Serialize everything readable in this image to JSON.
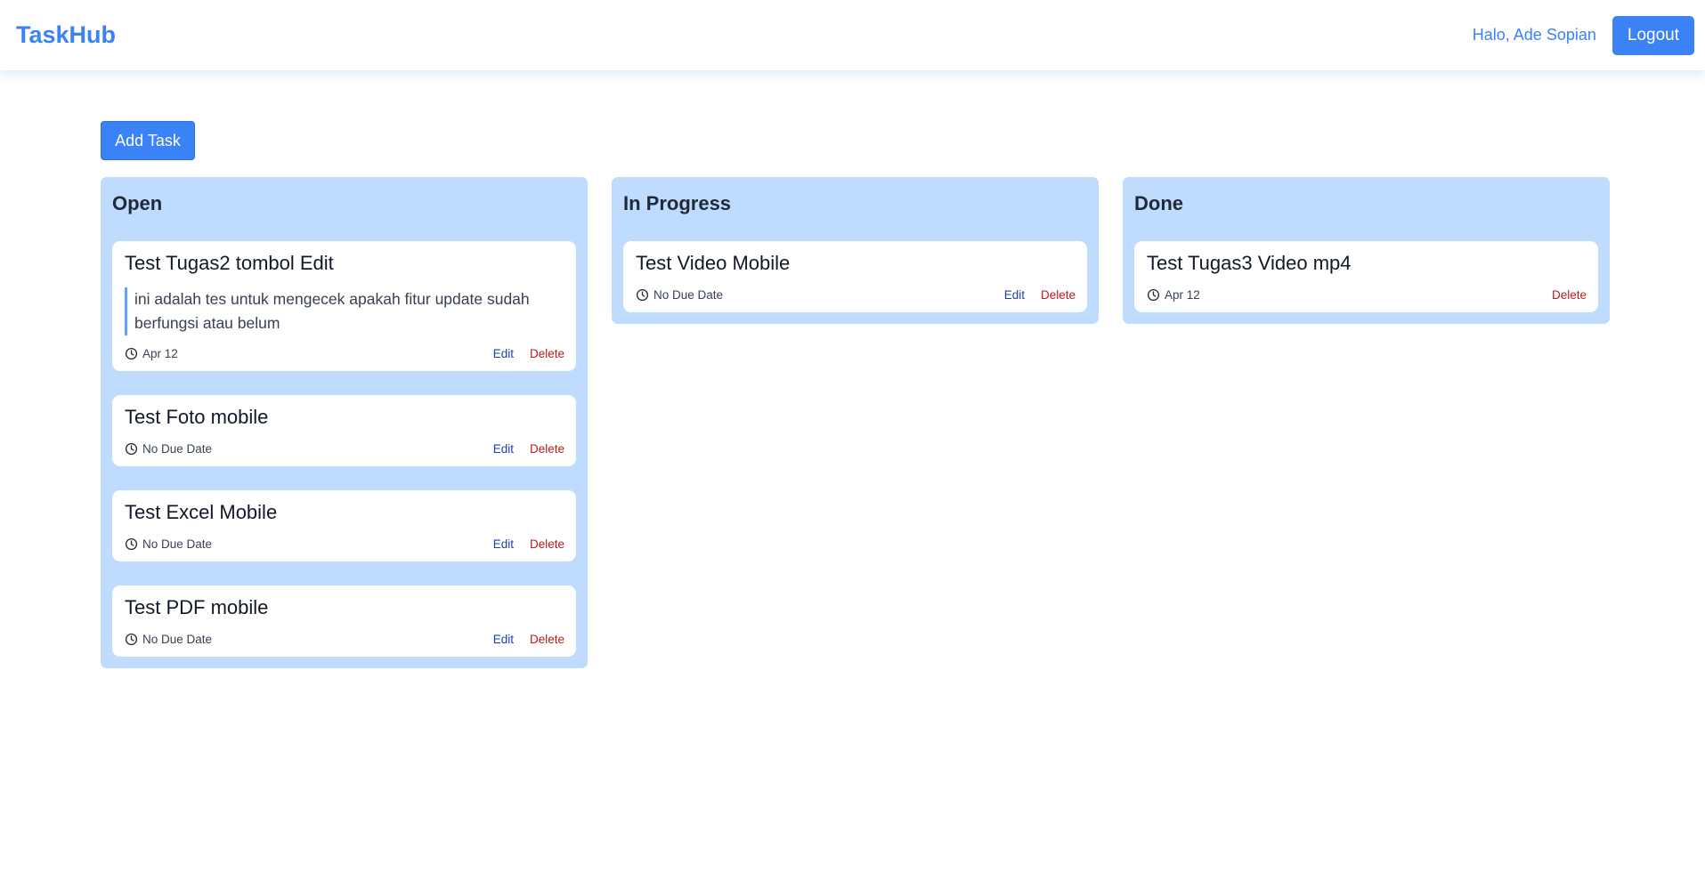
{
  "navbar": {
    "brand": "TaskHub",
    "greeting": "Halo, Ade Sopian",
    "logout_label": "Logout"
  },
  "toolbar": {
    "add_task_label": "Add Task"
  },
  "colors": {
    "primary": "#3b82f6",
    "column_bg": "#bfdbfe",
    "edit_link": "#1e40af",
    "delete_link": "#b91c1c"
  },
  "columns": [
    {
      "title": "Open",
      "cards": [
        {
          "title": "Test Tugas2 tombol Edit",
          "description": "ini adalah tes untuk mengecek apakah fitur update sudah berfungsi atau belum",
          "due": "Apr 12",
          "edit_label": "Edit",
          "delete_label": "Delete"
        },
        {
          "title": "Test Foto mobile",
          "due": "No Due Date",
          "edit_label": "Edit",
          "delete_label": "Delete"
        },
        {
          "title": "Test Excel Mobile",
          "due": "No Due Date",
          "edit_label": "Edit",
          "delete_label": "Delete"
        },
        {
          "title": "Test PDF mobile",
          "due": "No Due Date",
          "edit_label": "Edit",
          "delete_label": "Delete"
        }
      ]
    },
    {
      "title": "In Progress",
      "cards": [
        {
          "title": "Test Video Mobile",
          "due": "No Due Date",
          "edit_label": "Edit",
          "delete_label": "Delete"
        }
      ]
    },
    {
      "title": "Done",
      "cards": [
        {
          "title": "Test Tugas3 Video mp4",
          "due": "Apr 12",
          "delete_label": "Delete"
        }
      ]
    }
  ]
}
